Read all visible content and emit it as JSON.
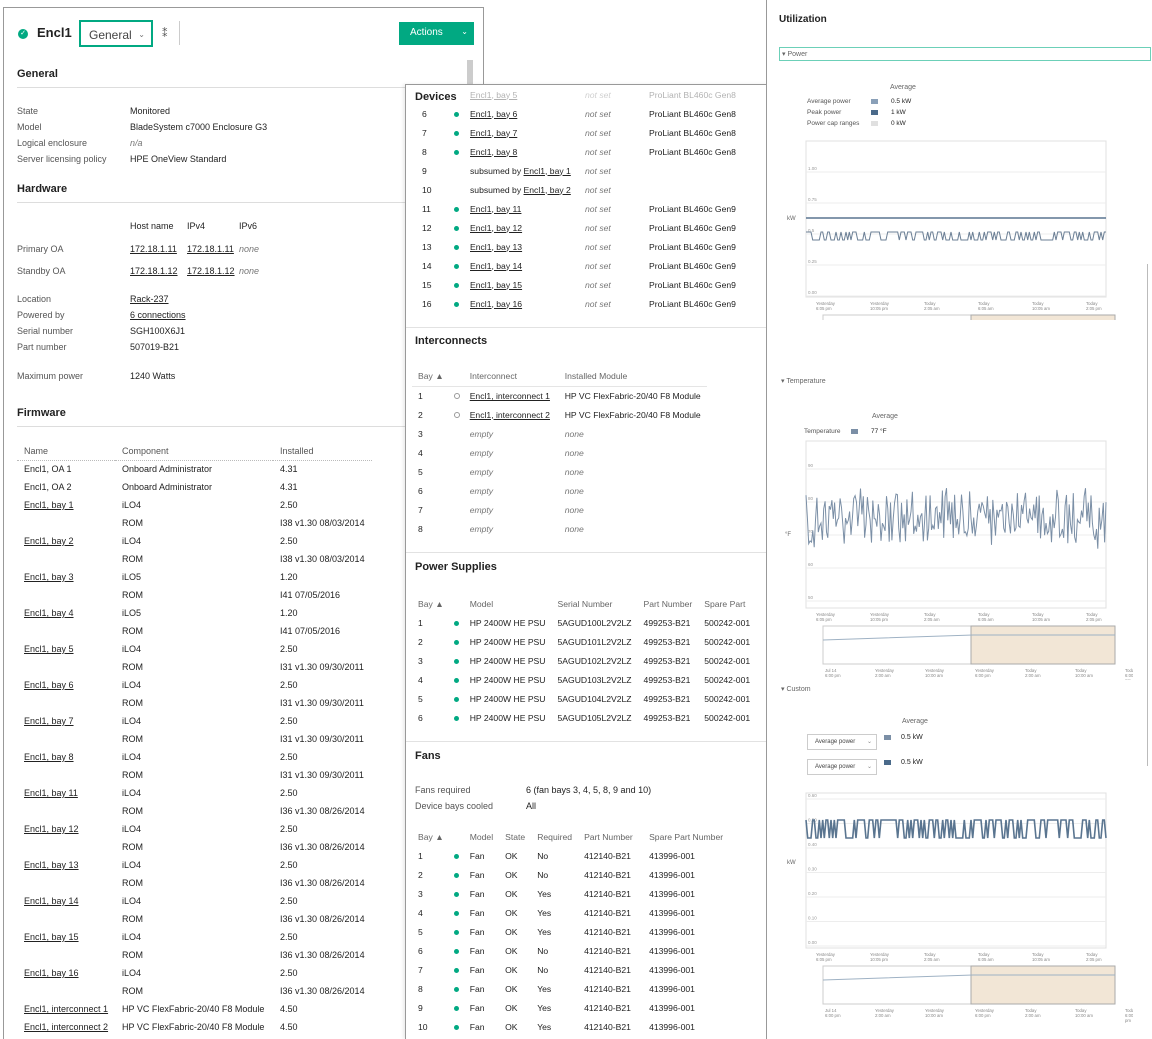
{
  "header": {
    "title": "Encl1",
    "view_label": "General",
    "actions_label": "Actions"
  },
  "general": {
    "title": "General",
    "fields": [
      {
        "label": "State",
        "value": "Monitored",
        "italic": false
      },
      {
        "label": "Model",
        "value": "BladeSystem c7000 Enclosure G3",
        "italic": false
      },
      {
        "label": "Logical enclosure",
        "value": "n/a",
        "italic": true
      },
      {
        "label": "Server licensing policy",
        "value": "HPE OneView Standard",
        "italic": false
      }
    ]
  },
  "hardware": {
    "title": "Hardware",
    "cols": [
      "Host name",
      "IPv4",
      "IPv6"
    ],
    "rows": [
      {
        "label": "Primary OA",
        "host": "172.18.1.11",
        "ipv4": "172.18.1.11",
        "ipv6": "none"
      },
      {
        "label": "Standby OA",
        "host": "172.18.1.12",
        "ipv4": "172.18.1.12",
        "ipv6": "none"
      }
    ],
    "fields": [
      {
        "label": "Location",
        "value": "Rack-237",
        "link": true
      },
      {
        "label": "Powered by",
        "value": "6 connections",
        "link": true
      },
      {
        "label": "Serial number",
        "value": "SGH100X6J1",
        "link": false
      },
      {
        "label": "Part number",
        "value": "507019-B21",
        "link": false
      }
    ],
    "max_power_label": "Maximum power",
    "max_power": "1240 Watts"
  },
  "firmware": {
    "title": "Firmware",
    "cols": [
      "Name",
      "Component",
      "Installed"
    ],
    "rows": [
      [
        "Encl1, OA 1",
        "Onboard Administrator",
        "4.31",
        false
      ],
      [
        "Encl1, OA 2",
        "Onboard Administrator",
        "4.31",
        false
      ],
      [
        "Encl1, bay 1",
        "iLO4",
        "2.50",
        true
      ],
      [
        "",
        "ROM",
        "I38 v1.30 08/03/2014",
        false
      ],
      [
        "Encl1, bay 2",
        "iLO4",
        "2.50",
        true
      ],
      [
        "",
        "ROM",
        "I38 v1.30 08/03/2014",
        false
      ],
      [
        "Encl1, bay 3",
        "iLO5",
        "1.20",
        true
      ],
      [
        "",
        "ROM",
        "I41 07/05/2016",
        false
      ],
      [
        "Encl1, bay 4",
        "iLO5",
        "1.20",
        true
      ],
      [
        "",
        "ROM",
        "I41 07/05/2016",
        false
      ],
      [
        "Encl1, bay 5",
        "iLO4",
        "2.50",
        true
      ],
      [
        "",
        "ROM",
        "I31 v1.30 09/30/2011",
        false
      ],
      [
        "Encl1, bay 6",
        "iLO4",
        "2.50",
        true
      ],
      [
        "",
        "ROM",
        "I31 v1.30 09/30/2011",
        false
      ],
      [
        "Encl1, bay 7",
        "iLO4",
        "2.50",
        true
      ],
      [
        "",
        "ROM",
        "I31 v1.30 09/30/2011",
        false
      ],
      [
        "Encl1, bay 8",
        "iLO4",
        "2.50",
        true
      ],
      [
        "",
        "ROM",
        "I31 v1.30 09/30/2011",
        false
      ],
      [
        "Encl1, bay 11",
        "iLO4",
        "2.50",
        true
      ],
      [
        "",
        "ROM",
        "I36 v1.30 08/26/2014",
        false
      ],
      [
        "Encl1, bay 12",
        "iLO4",
        "2.50",
        true
      ],
      [
        "",
        "ROM",
        "I36 v1.30 08/26/2014",
        false
      ],
      [
        "Encl1, bay 13",
        "iLO4",
        "2.50",
        true
      ],
      [
        "",
        "ROM",
        "I36 v1.30 08/26/2014",
        false
      ],
      [
        "Encl1, bay 14",
        "iLO4",
        "2.50",
        true
      ],
      [
        "",
        "ROM",
        "I36 v1.30 08/26/2014",
        false
      ],
      [
        "Encl1, bay 15",
        "iLO4",
        "2.50",
        true
      ],
      [
        "",
        "ROM",
        "I36 v1.30 08/26/2014",
        false
      ],
      [
        "Encl1, bay 16",
        "iLO4",
        "2.50",
        true
      ],
      [
        "",
        "ROM",
        "I36 v1.30 08/26/2014",
        false
      ],
      [
        "Encl1, interconnect 1",
        "HP VC FlexFabric-20/40 F8 Module",
        "4.50",
        true
      ],
      [
        "Encl1, interconnect 2",
        "HP VC FlexFabric-20/40 F8 Module",
        "4.50",
        true
      ]
    ]
  },
  "devices": {
    "title": "Devices",
    "rows": [
      [
        "",
        "",
        "Encl1, bay 5",
        "not set",
        "ProLiant BL460c Gen8"
      ],
      [
        "6",
        "dot",
        "Encl1, bay 6",
        "not set",
        "ProLiant BL460c Gen8"
      ],
      [
        "7",
        "dot",
        "Encl1, bay 7",
        "not set",
        "ProLiant BL460c Gen8"
      ],
      [
        "8",
        "dot",
        "Encl1, bay 8",
        "not set",
        "ProLiant BL460c Gen8"
      ],
      [
        "9",
        "",
        "subsumed by |Encl1, bay 1",
        "not set",
        ""
      ],
      [
        "10",
        "",
        "subsumed by |Encl1, bay 2",
        "not set",
        ""
      ],
      [
        "11",
        "dot",
        "Encl1, bay 11",
        "not set",
        "ProLiant BL460c Gen9"
      ],
      [
        "12",
        "dot",
        "Encl1, bay 12",
        "not set",
        "ProLiant BL460c Gen9"
      ],
      [
        "13",
        "dot",
        "Encl1, bay 13",
        "not set",
        "ProLiant BL460c Gen9"
      ],
      [
        "14",
        "dot",
        "Encl1, bay 14",
        "not set",
        "ProLiant BL460c Gen9"
      ],
      [
        "15",
        "dot",
        "Encl1, bay 15",
        "not set",
        "ProLiant BL460c Gen9"
      ],
      [
        "16",
        "dot",
        "Encl1, bay 16",
        "not set",
        "ProLiant BL460c Gen9"
      ]
    ]
  },
  "interconnects": {
    "title": "Interconnects",
    "cols": [
      "Bay ▲",
      "",
      "Interconnect",
      "Installed Module"
    ],
    "rows": [
      [
        "1",
        "odot",
        "Encl1, interconnect 1",
        "HP VC FlexFabric-20/40 F8 Module"
      ],
      [
        "2",
        "odot",
        "Encl1, interconnect 2",
        "HP VC FlexFabric-20/40 F8 Module"
      ],
      [
        "3",
        "",
        "empty",
        "none"
      ],
      [
        "4",
        "",
        "empty",
        "none"
      ],
      [
        "5",
        "",
        "empty",
        "none"
      ],
      [
        "6",
        "",
        "empty",
        "none"
      ],
      [
        "7",
        "",
        "empty",
        "none"
      ],
      [
        "8",
        "",
        "empty",
        "none"
      ]
    ]
  },
  "power_supplies": {
    "title": "Power Supplies",
    "cols": [
      "Bay ▲",
      "",
      "Model",
      "Serial Number",
      "Part Number",
      "Spare Part"
    ],
    "rows": [
      [
        "1",
        "dot",
        "HP 2400W HE PSU",
        "5AGUD100L2V2LZ",
        "499253-B21",
        "500242-001"
      ],
      [
        "2",
        "dot",
        "HP 2400W HE PSU",
        "5AGUD101L2V2LZ",
        "499253-B21",
        "500242-001"
      ],
      [
        "3",
        "dot",
        "HP 2400W HE PSU",
        "5AGUD102L2V2LZ",
        "499253-B21",
        "500242-001"
      ],
      [
        "4",
        "dot",
        "HP 2400W HE PSU",
        "5AGUD103L2V2LZ",
        "499253-B21",
        "500242-001"
      ],
      [
        "5",
        "dot",
        "HP 2400W HE PSU",
        "5AGUD104L2V2LZ",
        "499253-B21",
        "500242-001"
      ],
      [
        "6",
        "dot",
        "HP 2400W HE PSU",
        "5AGUD105L2V2LZ",
        "499253-B21",
        "500242-001"
      ]
    ]
  },
  "fans": {
    "title": "Fans",
    "required_label": "Fans required",
    "required_value": "6  (fan bays 3, 4, 5, 8, 9 and 10)",
    "cooled_label": "Device bays cooled",
    "cooled_value": "All",
    "cols": [
      "Bay ▲",
      "",
      "Model",
      "State",
      "Required",
      "Part Number",
      "Spare Part Number"
    ],
    "rows": [
      [
        "1",
        "dot",
        "Fan",
        "OK",
        "No",
        "412140-B21",
        "413996-001"
      ],
      [
        "2",
        "dot",
        "Fan",
        "OK",
        "No",
        "412140-B21",
        "413996-001"
      ],
      [
        "3",
        "dot",
        "Fan",
        "OK",
        "Yes",
        "412140-B21",
        "413996-001"
      ],
      [
        "4",
        "dot",
        "Fan",
        "OK",
        "Yes",
        "412140-B21",
        "413996-001"
      ],
      [
        "5",
        "dot",
        "Fan",
        "OK",
        "Yes",
        "412140-B21",
        "413996-001"
      ],
      [
        "6",
        "dot",
        "Fan",
        "OK",
        "No",
        "412140-B21",
        "413996-001"
      ],
      [
        "7",
        "dot",
        "Fan",
        "OK",
        "No",
        "412140-B21",
        "413996-001"
      ],
      [
        "8",
        "dot",
        "Fan",
        "OK",
        "Yes",
        "412140-B21",
        "413996-001"
      ],
      [
        "9",
        "dot",
        "Fan",
        "OK",
        "Yes",
        "412140-B21",
        "413996-001"
      ],
      [
        "10",
        "dot",
        "Fan",
        "OK",
        "Yes",
        "412140-B21",
        "413996-001"
      ]
    ]
  },
  "utilization": {
    "title": "Utilization",
    "power": {
      "label": "Power",
      "avg_header": "Average",
      "legend": [
        {
          "name": "Average power",
          "value": "0.5 kW",
          "color": "#8aa0b8"
        },
        {
          "name": "Peak power",
          "value": "1 kW",
          "color": "#4a6a8a"
        },
        {
          "name": "Power cap ranges",
          "value": "0 kW",
          "color": "#e0e0e0"
        }
      ],
      "unit": "kW",
      "yticks": [
        "1.00",
        "0.75",
        "0.5",
        "0.25",
        "0.00"
      ]
    },
    "temperature": {
      "label": "Temperature",
      "avg_header": "Average",
      "legend": [
        {
          "name": "Temperature",
          "value": "77 °F",
          "color": "#7b8fa6"
        }
      ],
      "unit": "°F",
      "yticks": [
        "90",
        "80",
        "70",
        "60",
        "50"
      ]
    },
    "custom": {
      "label": "Custom",
      "avg_header": "Average",
      "select1": "Average power",
      "value1": "0.5 kW",
      "select2": "Average power",
      "value2": "0.5 kW",
      "unit": "kW",
      "yticks": [
        "0.60",
        "0.50",
        "0.40",
        "0.30",
        "0.20",
        "0.10",
        "0.00"
      ]
    },
    "xticks": [
      [
        "Yesterday",
        "6:05 pm"
      ],
      [
        "Yesterday",
        "10:05 pm"
      ],
      [
        "Today",
        "2:05 am"
      ],
      [
        "Today",
        "6:05 am"
      ],
      [
        "Today",
        "10:05 am"
      ],
      [
        "Today",
        "2:05 pm"
      ]
    ],
    "nav_ticks": [
      [
        "Jul 14",
        "6:00 pm"
      ],
      [
        "Yesterday",
        "2:00 am"
      ],
      [
        "Yesterday",
        "10:00 am"
      ],
      [
        "Yesterday",
        "6:00 pm"
      ],
      [
        "Today",
        "2:00 am"
      ],
      [
        "Today",
        "10:00 am"
      ],
      [
        "Today",
        "6:00",
        "pm"
      ]
    ]
  },
  "colors": {
    "accent": "#01a982",
    "status_ok": "#01a982"
  }
}
